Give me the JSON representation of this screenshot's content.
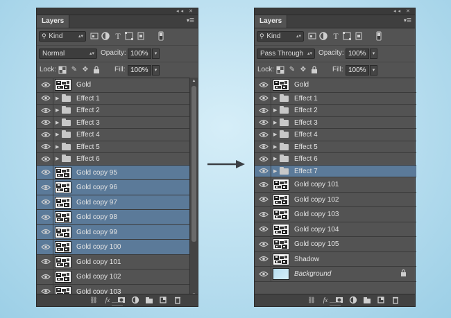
{
  "left_panel": {
    "tab_label": "Layers",
    "filter_kind": "Kind",
    "blend_mode": "Normal",
    "opacity_label": "Opacity:",
    "opacity_value": "100%",
    "lock_label": "Lock:",
    "fill_label": "Fill:",
    "fill_value": "100%",
    "layers": [
      {
        "name": "Gold",
        "type": "thumb",
        "selected": false
      },
      {
        "name": "Effect 1",
        "type": "group",
        "selected": false
      },
      {
        "name": "Effect 2",
        "type": "group",
        "selected": false
      },
      {
        "name": "Effect 3",
        "type": "group",
        "selected": false
      },
      {
        "name": "Effect 4",
        "type": "group",
        "selected": false
      },
      {
        "name": "Effect 5",
        "type": "group",
        "selected": false
      },
      {
        "name": "Effect 6",
        "type": "group",
        "selected": false
      },
      {
        "name": "Gold copy 95",
        "type": "thumb",
        "selected": true
      },
      {
        "name": "Gold copy 96",
        "type": "thumb",
        "selected": true
      },
      {
        "name": "Gold copy 97",
        "type": "thumb",
        "selected": true
      },
      {
        "name": "Gold copy 98",
        "type": "thumb",
        "selected": true
      },
      {
        "name": "Gold copy 99",
        "type": "thumb",
        "selected": true
      },
      {
        "name": "Gold copy 100",
        "type": "thumb",
        "selected": true
      },
      {
        "name": "Gold copy 101",
        "type": "thumb",
        "selected": false
      },
      {
        "name": "Gold copy 102",
        "type": "thumb",
        "selected": false
      },
      {
        "name": "Gold copy 103",
        "type": "thumb",
        "selected": false
      }
    ]
  },
  "right_panel": {
    "tab_label": "Layers",
    "filter_kind": "Kind",
    "blend_mode": "Pass Through",
    "opacity_label": "Opacity:",
    "opacity_value": "100%",
    "lock_label": "Lock:",
    "fill_label": "Fill:",
    "fill_value": "100%",
    "layers": [
      {
        "name": "Gold",
        "type": "thumb",
        "selected": false
      },
      {
        "name": "Effect 1",
        "type": "group",
        "selected": false
      },
      {
        "name": "Effect 2",
        "type": "group",
        "selected": false
      },
      {
        "name": "Effect 3",
        "type": "group",
        "selected": false
      },
      {
        "name": "Effect 4",
        "type": "group",
        "selected": false
      },
      {
        "name": "Effect 5",
        "type": "group",
        "selected": false
      },
      {
        "name": "Effect 6",
        "type": "group",
        "selected": false
      },
      {
        "name": "Effect 7",
        "type": "group",
        "selected": true
      },
      {
        "name": "Gold copy 101",
        "type": "thumb",
        "selected": false
      },
      {
        "name": "Gold copy 102",
        "type": "thumb",
        "selected": false
      },
      {
        "name": "Gold copy 103",
        "type": "thumb",
        "selected": false
      },
      {
        "name": "Gold copy 104",
        "type": "thumb",
        "selected": false
      },
      {
        "name": "Gold copy 105",
        "type": "thumb",
        "selected": false
      },
      {
        "name": "Shadow",
        "type": "thumb",
        "selected": false
      },
      {
        "name": "Background",
        "type": "background",
        "selected": false,
        "locked": true
      }
    ]
  },
  "colors": {
    "panel_bg": "#535353",
    "selection": "#5b7a99",
    "page_bg": "#b5dcee"
  },
  "icons": {
    "arrow": "right-arrow-icon",
    "eye": "eye-icon",
    "folder": "folder-icon",
    "bottom_bar": [
      "link-layers-icon",
      "fx-icon",
      "mask-icon",
      "adjustment-icon",
      "new-group-icon",
      "new-layer-icon",
      "trash-icon"
    ]
  }
}
